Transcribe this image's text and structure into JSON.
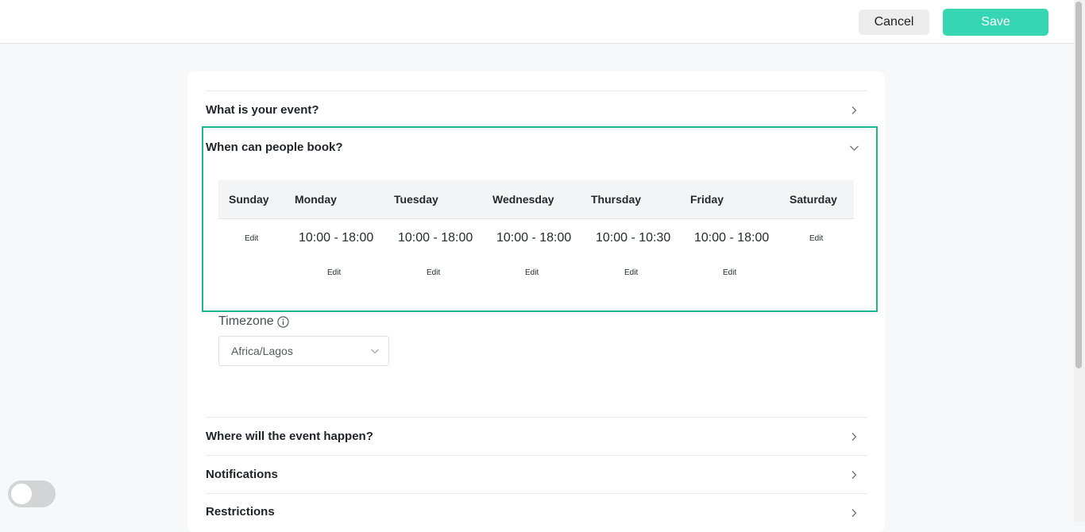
{
  "header": {
    "cancel_label": "Cancel",
    "save_label": "Save"
  },
  "sections": {
    "what": {
      "title": "What is your event?"
    },
    "when": {
      "title": "When can people book?"
    },
    "where": {
      "title": "Where will the event happen?"
    },
    "notifications": {
      "title": "Notifications"
    },
    "restrictions": {
      "title": "Restrictions"
    }
  },
  "schedule": {
    "days": [
      "Sunday",
      "Monday",
      "Tuesday",
      "Wednesday",
      "Thursday",
      "Friday",
      "Saturday"
    ],
    "times": [
      "",
      "10:00 - 18:00",
      "10:00 - 18:00",
      "10:00 - 18:00",
      "10:00 - 10:30",
      "10:00 - 18:00",
      ""
    ],
    "edit_label": "Edit"
  },
  "timezone": {
    "label": "Timezone",
    "value": "Africa/Lagos"
  },
  "colors": {
    "accent": "#36d6b5",
    "active_border": "#1db594"
  },
  "toggle": {
    "on": false
  }
}
